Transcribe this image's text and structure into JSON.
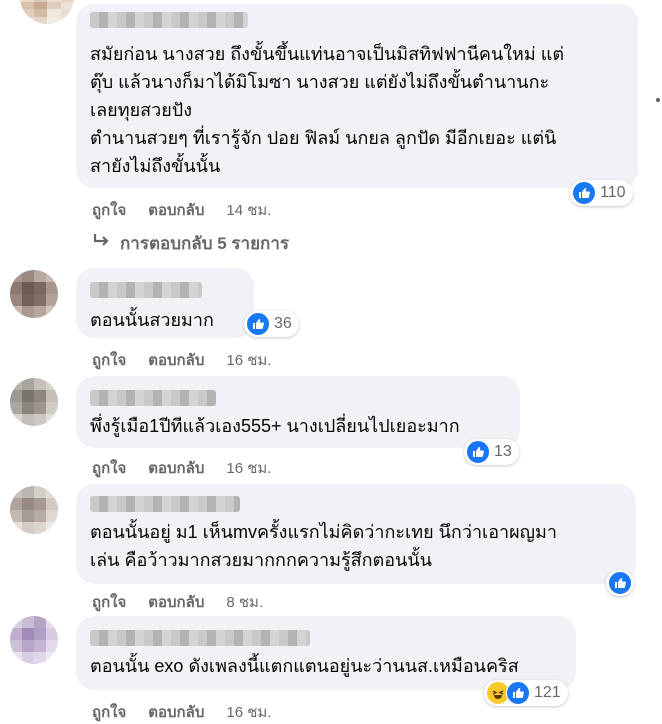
{
  "comments": [
    {
      "text": "สมัยก่อน นางสวย ถึงขั้นขึ้นแท่นอาจเป็นมิสทิฟฟานีคนใหม่ แต่\nตุ๊บ แล้วนางก็มาได้มิโมซา นางสวย แต่ยังไม่ถึงขั้นตำนานกะ\nเลยทุยสวยปัง\nตำนานสวยๆ ที่เรารู้จัก ปอย ฟิลม์ นกยล ลูกปัด มีอีกเยอะ แต่นิ\nสายังไม่ถึงขั้นนั้น",
      "like_label": "ถูกใจ",
      "reply_label": "ตอบกลับ",
      "time": "14 ชม.",
      "reaction_count": "110",
      "reaction_type": "like-icon"
    },
    {
      "text": "ตอนนั้นสวยมาก",
      "like_label": "ถูกใจ",
      "reply_label": "ตอบกลับ",
      "time": "16 ชม.",
      "reaction_count": "36",
      "reaction_type": "like-icon"
    },
    {
      "text": "พึ่งรู้เมือ1ปีทีแล้วเอง555+ นางเปลี่ยนไปเยอะมาก",
      "like_label": "ถูกใจ",
      "reply_label": "ตอบกลับ",
      "time": "16 ชม.",
      "reaction_count": "13",
      "reaction_type": "like-icon"
    },
    {
      "text": "ตอนนั้นอยู่ ม1 เห็นmvครั้งแรกไม่คิดว่ากะเทย นึกว่าเอาผญมา\nเล่น คือว้าวมากสวยมากกกความรู้สึกตอนนั้น",
      "like_label": "ถูกใจ",
      "reply_label": "ตอบกลับ",
      "time": "8 ชม.",
      "reaction_count": "",
      "reaction_type": "like-icon"
    },
    {
      "text": "ตอนนั้น exo ดังเพลงนี้แตกแตนอยู่นะว่านนส.เหมือนคริส",
      "like_label": "ถูกใจ",
      "reply_label": "ตอบกลับ",
      "time": "16 ชม.",
      "reaction_count": "121",
      "reaction_type": "haha-icon"
    }
  ],
  "replies_link": "การตอบกลับ 5 รายการ",
  "colors": {
    "like_blue": "#1877f2",
    "bubble": "#f0f2f5",
    "meta": "#65676b"
  }
}
